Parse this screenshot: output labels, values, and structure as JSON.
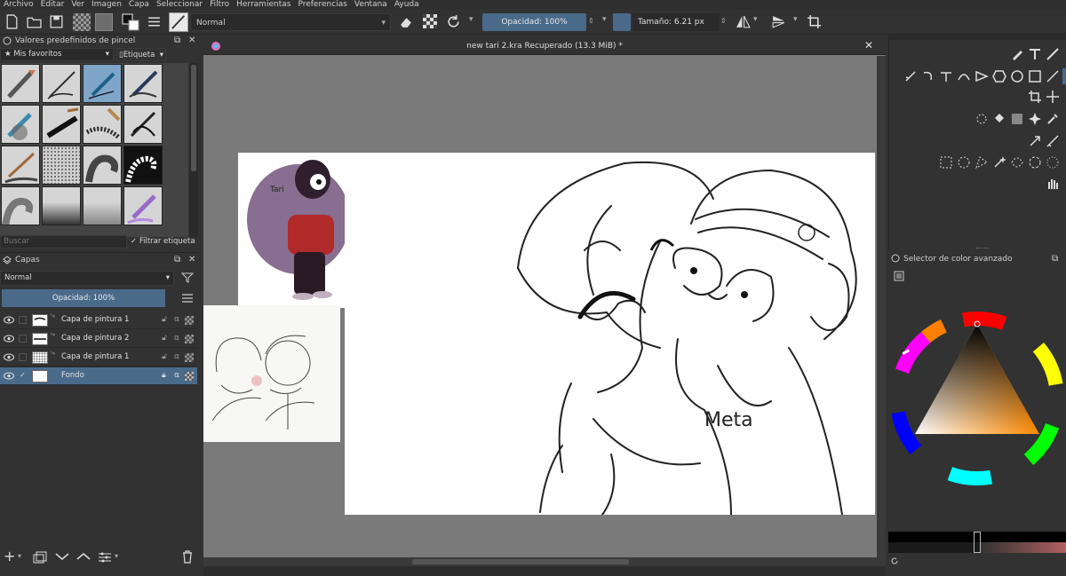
{
  "menubar": [
    "Archivo",
    "Editar",
    "Ver",
    "Imagen",
    "Capa",
    "Seleccionar",
    "Filtro",
    "Herramientas",
    "Preferencias",
    "Ventana",
    "Ayuda"
  ],
  "toolbar": {
    "blend_mode": "Normal",
    "opacity": "Opacidad: 100%",
    "size": "Tamaño: 6.21 px"
  },
  "brush_presets": {
    "title": "Valores predefinidos de pincel",
    "favorites": "Mis favoritos",
    "tag": "Etiqueta",
    "search_placeholder": "Buscar",
    "filter_tag": "Filtrar etiqueta"
  },
  "layers": {
    "title": "Capas",
    "blend_mode": "Normal",
    "opacity": "Opacidad:  100%",
    "items": [
      {
        "name": "Capa de pintura 1",
        "selected": false
      },
      {
        "name": "Capa de pintura 2",
        "selected": false
      },
      {
        "name": "Capa de pintura 1",
        "selected": false
      },
      {
        "name": "Fondo",
        "selected": true
      }
    ]
  },
  "document": {
    "title": "new tari 2.kra Recuperado (13.3 MiB) *",
    "drawing_text": "Meta",
    "signature": "Tari"
  },
  "color_selector": {
    "title": "Selector de color avanzado"
  },
  "colors": {
    "accent": "#4a6a8a",
    "panel": "#323232",
    "canvas_bg": "#7a7a7a"
  }
}
